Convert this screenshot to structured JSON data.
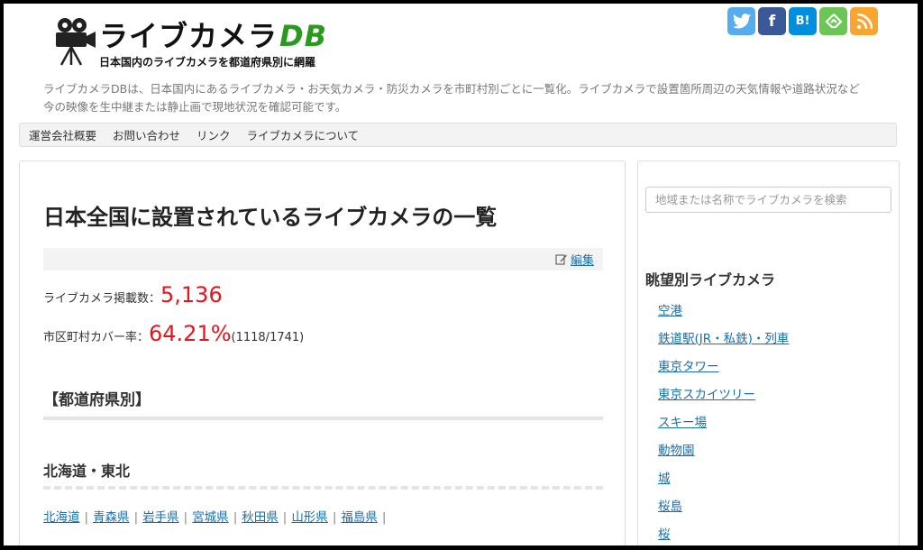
{
  "header": {
    "logo_title": "ライブカメラ",
    "logo_title_accent": "DB",
    "logo_subtitle": "日本国内のライブカメラを都道府県別に網羅",
    "description": "ライブカメラDBは、日本国内にあるライブカメラ・お天気カメラ・防災カメラを市町村別ごとに一覧化。ライブカメラで設置箇所周辺の天気情報や道路状況など今の映像を生中継または静止画で現地状況を確認可能です。",
    "social": [
      {
        "icon": "twitter-icon",
        "glyph": "t",
        "color": "#55acee"
      },
      {
        "icon": "facebook-icon",
        "glyph": "f",
        "color": "#3b5998"
      },
      {
        "icon": "hatena-bookmark-icon",
        "glyph": "B!",
        "color": "#008fde"
      },
      {
        "icon": "feedly-icon",
        "glyph": "f",
        "color": "#6cc655"
      },
      {
        "icon": "rss-icon",
        "glyph": "rss",
        "color": "#f8a532"
      }
    ]
  },
  "nav": {
    "items": [
      "運営会社概要",
      "お問い合わせ",
      "リンク",
      "ライブカメラについて"
    ]
  },
  "main": {
    "title": "日本全国に設置されているライブカメラの一覧",
    "edit_label": "編集",
    "stat_count_label": "ライブカメラ掲載数：",
    "stat_count_value": "5,136",
    "stat_cover_label": "市区町村カバー率：",
    "stat_cover_value": "64.21%",
    "stat_cover_detail": "(1118/1741)",
    "section_heading": "【都道府県別】",
    "region_heading": "北海道・東北",
    "prefectures": [
      "北海道",
      "青森県",
      "岩手県",
      "宮城県",
      "秋田県",
      "山形県",
      "福島県"
    ]
  },
  "sidebar": {
    "search_placeholder": "地域または名称でライブカメラを検索",
    "heading": "眺望別ライブカメラ",
    "items": [
      "空港",
      "鉄道駅(JR・私鉄)・列車",
      "東京タワー",
      "東京スカイツリー",
      "スキー場",
      "動物園",
      "城",
      "桜島",
      "桜"
    ]
  },
  "colors": {
    "accent_red": "#e8141c",
    "link_blue": "#1a6fb0",
    "logo_green": "#2a9a1e"
  }
}
